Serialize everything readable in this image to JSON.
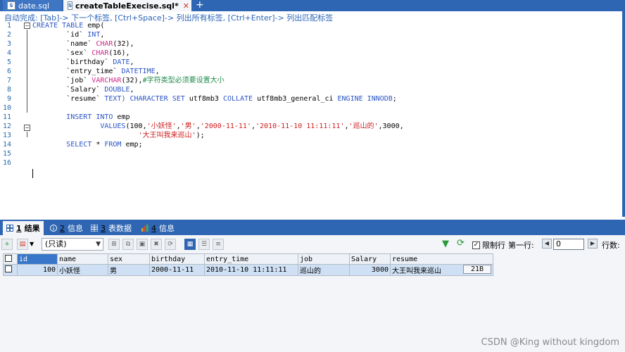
{
  "tabs": [
    {
      "label": "date.sql",
      "active": false
    },
    {
      "label": "createTableExecise.sql*",
      "active": true
    }
  ],
  "editor": {
    "hint": "自动完成: [Tab]-> 下一个标签, [Ctrl+Space]-> 列出所有标签, [Ctrl+Enter]-> 列出匹配标签",
    "line_numbers": [
      "1",
      "2",
      "3",
      "4",
      "5",
      "6",
      "7",
      "8",
      "9",
      "10",
      "11",
      "12",
      "13",
      "14",
      "15",
      "16"
    ]
  },
  "result_tabs": [
    {
      "num": "1",
      "label": "结果"
    },
    {
      "num": "2",
      "label": "信息"
    },
    {
      "num": "3",
      "label": "表数据"
    },
    {
      "num": "4",
      "label": "信息"
    }
  ],
  "toolbar": {
    "mode": "(只读)",
    "limit_label": "限制行",
    "first_row_label": "第一行:",
    "first_row_value": "0",
    "row_count_label": "行数:"
  },
  "grid": {
    "columns": [
      "id",
      "name",
      "sex",
      "birthday",
      "entry_time",
      "job",
      "Salary",
      "resume"
    ],
    "rows": [
      [
        "100",
        "小妖怪",
        "男",
        "2000-11-11",
        "2010-11-10 11:11:11",
        "巡山的",
        "3000",
        "大王叫我来巡山"
      ]
    ],
    "resume_size": "21B"
  },
  "watermark": "CSDN @King without kingdom",
  "colors": {
    "accent": "#2f66b3",
    "keyword": "#2b55c7",
    "string": "#cc1e1e",
    "type": "#cc2a8a",
    "comment": "#1f8a4a"
  }
}
